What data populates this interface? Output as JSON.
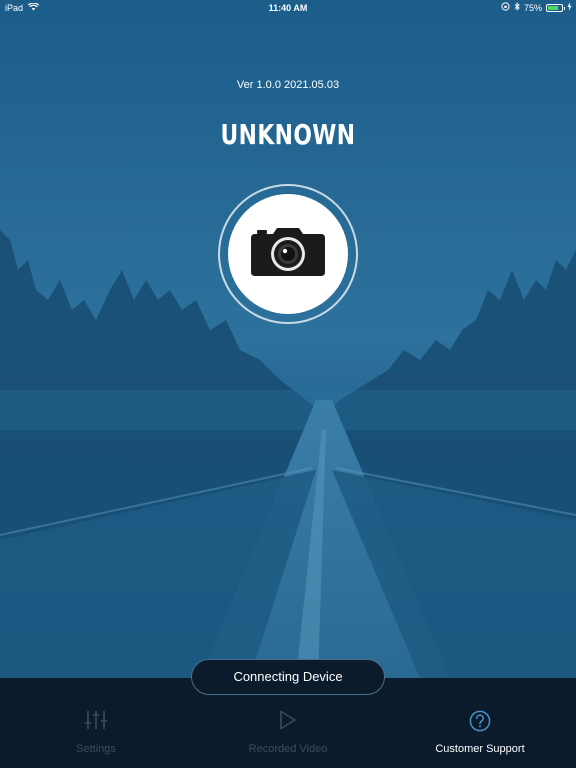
{
  "status_bar": {
    "device": "iPad",
    "time": "11:40 AM",
    "battery_percent": "75%",
    "battery_level": 0.75,
    "icons": [
      "wifi-icon",
      "orientation-lock-icon",
      "bluetooth-icon",
      "battery-icon",
      "charging-icon"
    ]
  },
  "header": {
    "version": "Ver 1.0.0 2021.05.03",
    "device_name": "UNKNOWN"
  },
  "camera": {
    "icon": "camera-icon"
  },
  "connection": {
    "status_label": "Connecting Device"
  },
  "tabs": [
    {
      "label": "Settings",
      "icon": "sliders-icon",
      "state": "disabled"
    },
    {
      "label": "Recorded Video",
      "icon": "play-icon",
      "state": "disabled"
    },
    {
      "label": "Customer Support",
      "icon": "question-icon",
      "state": "active"
    }
  ],
  "colors": {
    "background_tint": "#1f6592",
    "tab_bar": "#0b1b2c",
    "tab_active": "#ffffff",
    "tab_disabled": "#3b4c5c",
    "support_icon": "#4a90c8",
    "battery_fill": "#4cd964"
  }
}
